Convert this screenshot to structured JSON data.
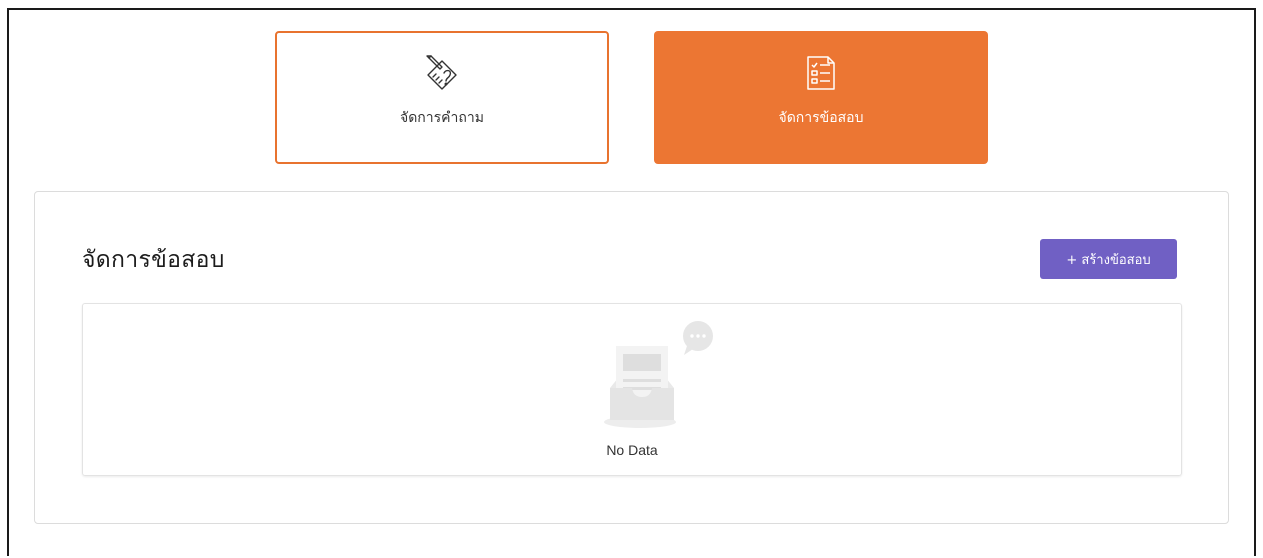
{
  "mode_tabs": [
    {
      "label": "จัดการคำถาม",
      "icon": "pencil-paper-icon",
      "active": false
    },
    {
      "label": "จัดการข้อสอบ",
      "icon": "checklist-icon",
      "active": true
    }
  ],
  "panel": {
    "title": "จัดการข้อสอบ",
    "create_button_label": "+ สร้างข้อสอบ"
  },
  "empty_state": {
    "text": "No Data",
    "icon": "empty-inbox-icon"
  },
  "colors": {
    "accent_orange": "#ec7633",
    "button_purple": "#7060c4"
  }
}
